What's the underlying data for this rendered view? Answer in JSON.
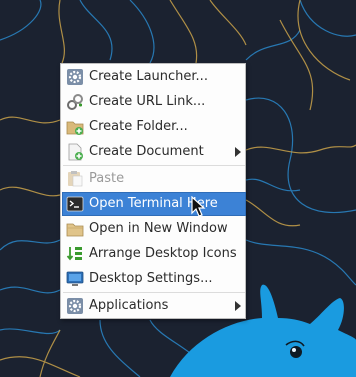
{
  "desktop": {
    "background_color": "#1b2230",
    "line_color_blue": "#2a87c9",
    "line_color_yellow": "#c9a24a",
    "mascot_color": "#1a9be0"
  },
  "context_menu": {
    "items": [
      {
        "label": "Create Launcher...",
        "icon": "gear-icon",
        "submenu": false,
        "disabled": false,
        "highlighted": false
      },
      {
        "label": "Create URL Link...",
        "icon": "link-icon",
        "submenu": false,
        "disabled": false,
        "highlighted": false
      },
      {
        "label": "Create Folder...",
        "icon": "folder-add-icon",
        "submenu": false,
        "disabled": false,
        "highlighted": false
      },
      {
        "label": "Create Document",
        "icon": "document-add-icon",
        "submenu": true,
        "disabled": false,
        "highlighted": false
      },
      {
        "label": "Paste",
        "icon": "paste-icon",
        "submenu": false,
        "disabled": true,
        "highlighted": false
      },
      {
        "label": "Open Terminal Here",
        "icon": "terminal-icon",
        "submenu": false,
        "disabled": false,
        "highlighted": true
      },
      {
        "label": "Open in New Window",
        "icon": "folder-icon",
        "submenu": false,
        "disabled": false,
        "highlighted": false
      },
      {
        "label": "Arrange Desktop Icons",
        "icon": "arrange-icon",
        "submenu": false,
        "disabled": false,
        "highlighted": false
      },
      {
        "label": "Desktop Settings...",
        "icon": "monitor-icon",
        "submenu": false,
        "disabled": false,
        "highlighted": false
      },
      {
        "label": "Applications",
        "icon": "applications-icon",
        "submenu": true,
        "disabled": false,
        "highlighted": false
      }
    ],
    "highlight_color": "#3c82d6"
  }
}
